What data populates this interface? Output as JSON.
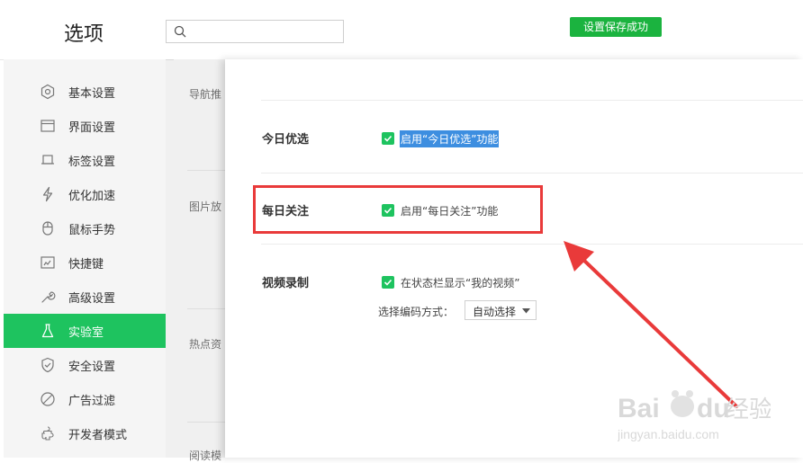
{
  "header": {
    "title": "选项",
    "search": {
      "placeholder": "",
      "value": ""
    },
    "toast": "设置保存成功"
  },
  "sidebar": {
    "items": [
      {
        "label": "基本设置",
        "icon": "settings-icon"
      },
      {
        "label": "界面设置",
        "icon": "window-icon"
      },
      {
        "label": "标签设置",
        "icon": "tab-icon"
      },
      {
        "label": "优化加速",
        "icon": "lightning-icon"
      },
      {
        "label": "鼠标手势",
        "icon": "mouse-icon"
      },
      {
        "label": "快捷键",
        "icon": "keyboard-icon"
      },
      {
        "label": "高级设置",
        "icon": "wrench-icon"
      },
      {
        "label": "实验室",
        "icon": "flask-icon",
        "active": true
      },
      {
        "label": "安全设置",
        "icon": "shield-icon"
      },
      {
        "label": "广告过滤",
        "icon": "block-icon"
      },
      {
        "label": "开发者模式",
        "icon": "puzzle-icon"
      }
    ]
  },
  "background_panel": {
    "labels": [
      "导航推",
      "图片放",
      "热点资",
      "阅读模"
    ]
  },
  "lab_panel": {
    "sections": [
      {
        "title": "今日优选",
        "option": "启用“今日优选”功能",
        "checked": true,
        "selected_text": true
      },
      {
        "title": "每日关注",
        "option": "启用“每日关注”功能",
        "checked": true,
        "highlighted_box": true
      },
      {
        "title": "视频录制",
        "option": "在状态栏显示“我的视频”",
        "checked": true,
        "encoding_label": "选择编码方式：",
        "encoding_value": "自动选择"
      }
    ]
  },
  "annotation": {
    "box_color": "#e93a3a",
    "arrow_color": "#e93a3a"
  },
  "watermark": {
    "brand": "Baidu经验",
    "url": "jingyan.baidu.com"
  },
  "colors": {
    "accent": "#1ec35f",
    "toast": "#1bb33f",
    "selection": "#3d8ee0"
  }
}
